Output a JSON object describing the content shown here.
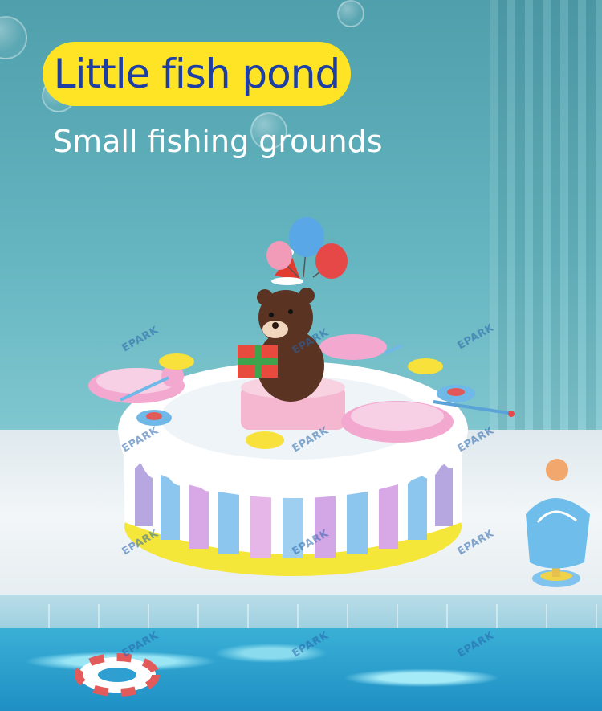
{
  "title": "Little fish pond",
  "subtitle": "Small fishing grounds",
  "watermark": "EPARK",
  "colors": {
    "title_pill": "#ffe425",
    "title_text": "#1d3fa5",
    "subtitle_text": "#ffffff",
    "wall": "#64b5c0",
    "water": "#1f8fc4"
  }
}
